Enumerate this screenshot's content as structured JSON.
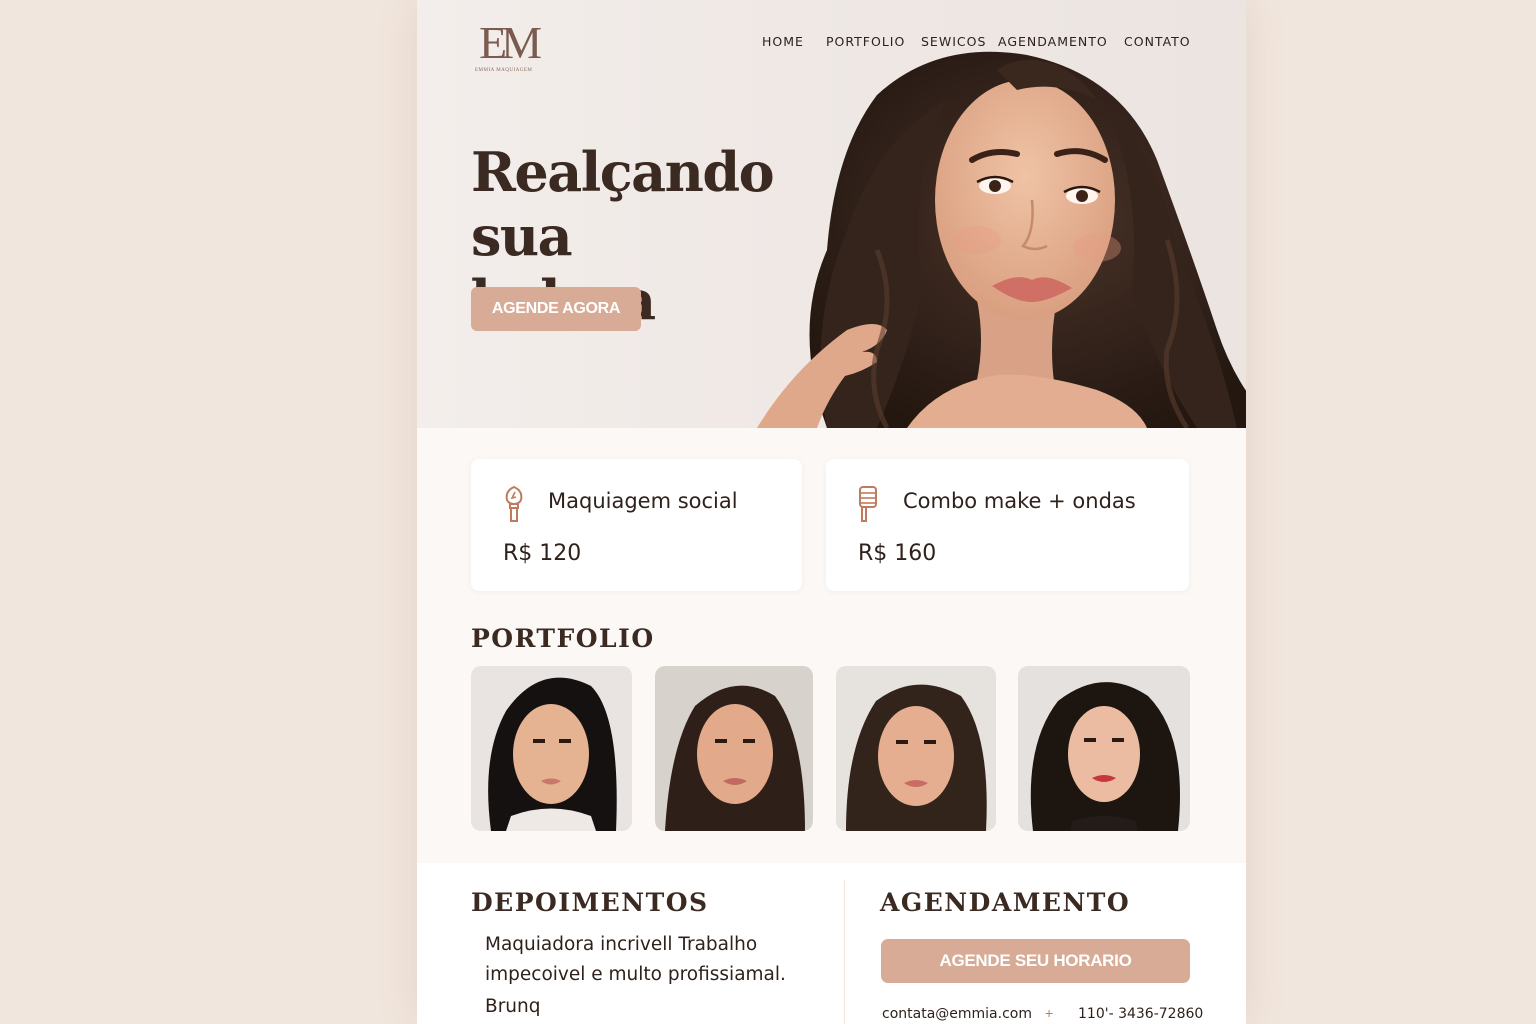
{
  "brand": {
    "logo_text": "EM",
    "logo_subtext": "EMMIA MAQUIAGEM"
  },
  "nav": {
    "items": [
      {
        "label": "HOME"
      },
      {
        "label": "PORTFOLIO"
      },
      {
        "label": "SEWICOS"
      },
      {
        "label": "AGENDAMENTO"
      },
      {
        "label": "CONTATO"
      }
    ]
  },
  "hero": {
    "title_line1": "Realçando",
    "title_line2": "sua beleza",
    "cta_label": "AGENDE AGORA"
  },
  "services": [
    {
      "icon": "makeup-brush-icon",
      "title": "Maquiagem social",
      "price": "R$ 120"
    },
    {
      "icon": "hair-curler-icon",
      "title": "Combo make + ondas",
      "price": "R$ 160"
    }
  ],
  "portfolio": {
    "title": "PORTFOLIO",
    "photos": [
      "look-1",
      "look-2",
      "look-3",
      "look-4"
    ]
  },
  "testimonials": {
    "title": "DEPOIMENTOS",
    "quote": "Maquiadora incrivell Trabalho impecoivel e multo profissiamal.",
    "author": "Brunq"
  },
  "booking": {
    "title": "AGENDAMENTO",
    "cta_label": "AGENDE SEU HORARIO",
    "email": "contata@emmia.com",
    "separator": "+",
    "phone": "110'- 3436-72860"
  },
  "colors": {
    "background": "#f1e6dd",
    "page": "#fbf8f5",
    "accent": "#d7ab96",
    "text_dark": "#3a2a22",
    "icon": "#c07b5e"
  }
}
